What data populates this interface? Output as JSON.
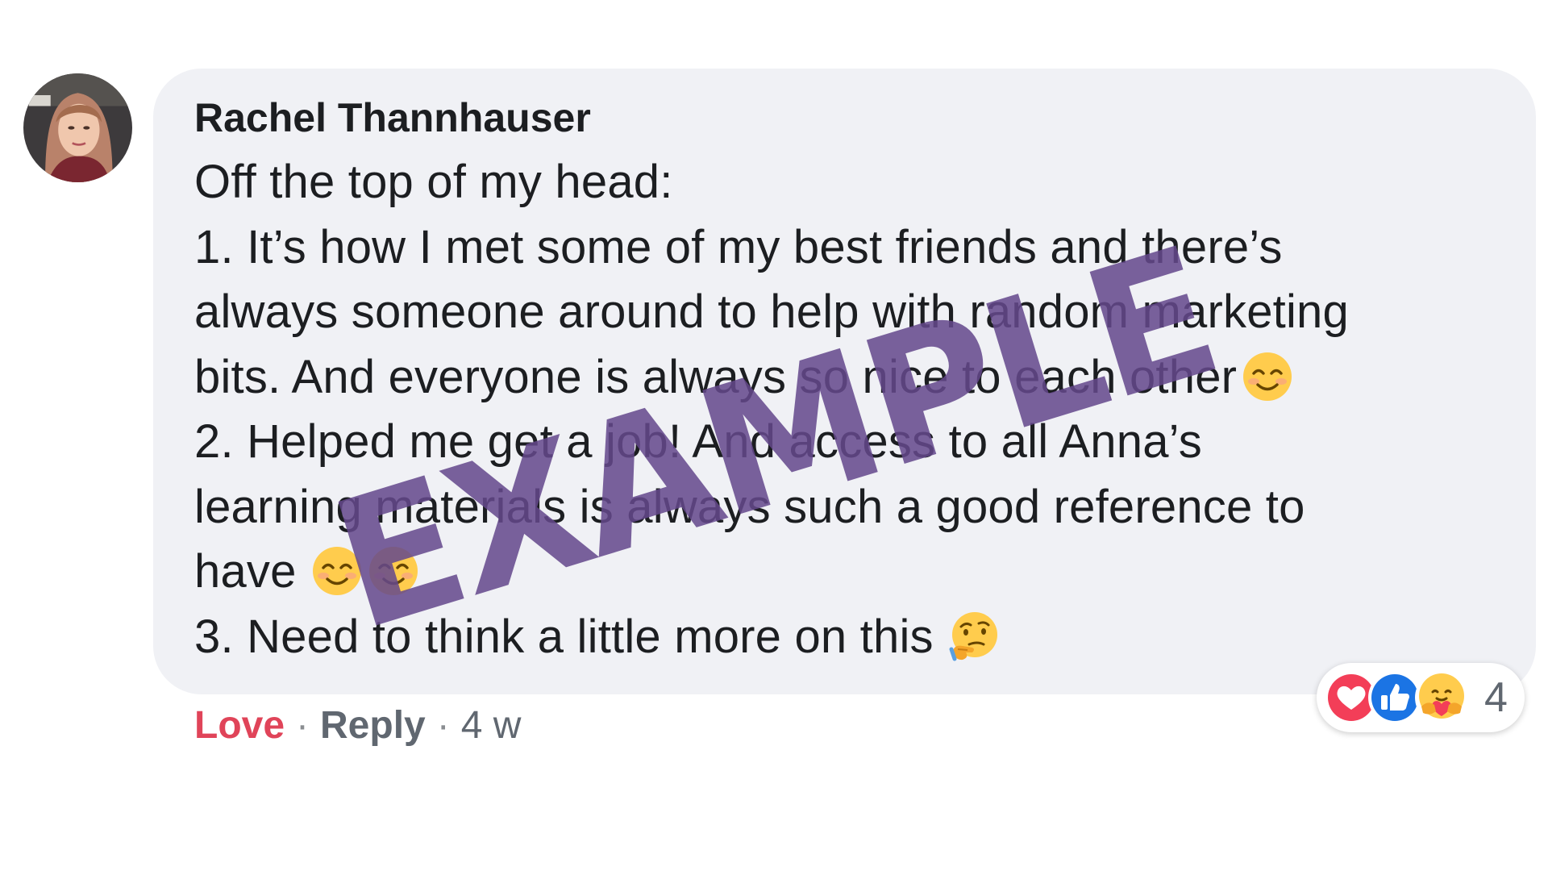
{
  "comment": {
    "author": "Rachel Thannhauser",
    "lines": [
      "Off the top of my head:",
      "1. It’s how I met some of my best friends and there’s",
      "always someone around to help with random marketing",
      "bits. And everyone is always so nice to each other",
      "2. Helped me get a job! And access to all Anna’s",
      "learning materials is always such a good reference to",
      "have",
      "3. Need to think a little more on this"
    ],
    "emoji": {
      "line4": "smiling-face-icon",
      "line7": [
        "smiling-face-icon",
        "smiling-face-icon"
      ],
      "line8": "thinking-face-icon"
    }
  },
  "watermark": "EXAMPLE",
  "actions": {
    "love_label": "Love",
    "separator": "·",
    "reply_label": "Reply",
    "time": "4 w"
  },
  "reactions": {
    "icons": [
      "heart-reaction-icon",
      "like-reaction-icon",
      "care-reaction-icon"
    ],
    "count": "4"
  },
  "colors": {
    "bubble": "#f0f1f5",
    "love": "#e04459",
    "watermark": "#64488c"
  }
}
